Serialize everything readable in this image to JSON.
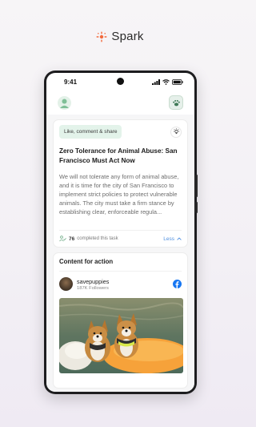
{
  "brand": {
    "name": "Spark"
  },
  "status_bar": {
    "time": "9:41"
  },
  "task": {
    "tag": "Like, comment & share",
    "title": "Zero Tolerance for Animal Abuse: San Francisco Must Act Now",
    "body": "We will not tolerate any form of animal abuse, and it is time for the city of San Francisco to implement strict policies to protect vulnerable animals. The city must take a firm stance by establishing clear, enforceable regula...",
    "completed_count": "76",
    "completed_text": "completed this task",
    "less_label": "Less"
  },
  "content_for_action": {
    "title": "Content for action",
    "post": {
      "username": "savepuppies",
      "followers": "187K Followers",
      "platform_icon": "facebook-icon"
    }
  },
  "colors": {
    "accent_orange": "#f26a3d",
    "tag_bg": "#e3f3ea",
    "link_blue": "#4e8fe0",
    "facebook_blue": "#1877f2"
  }
}
